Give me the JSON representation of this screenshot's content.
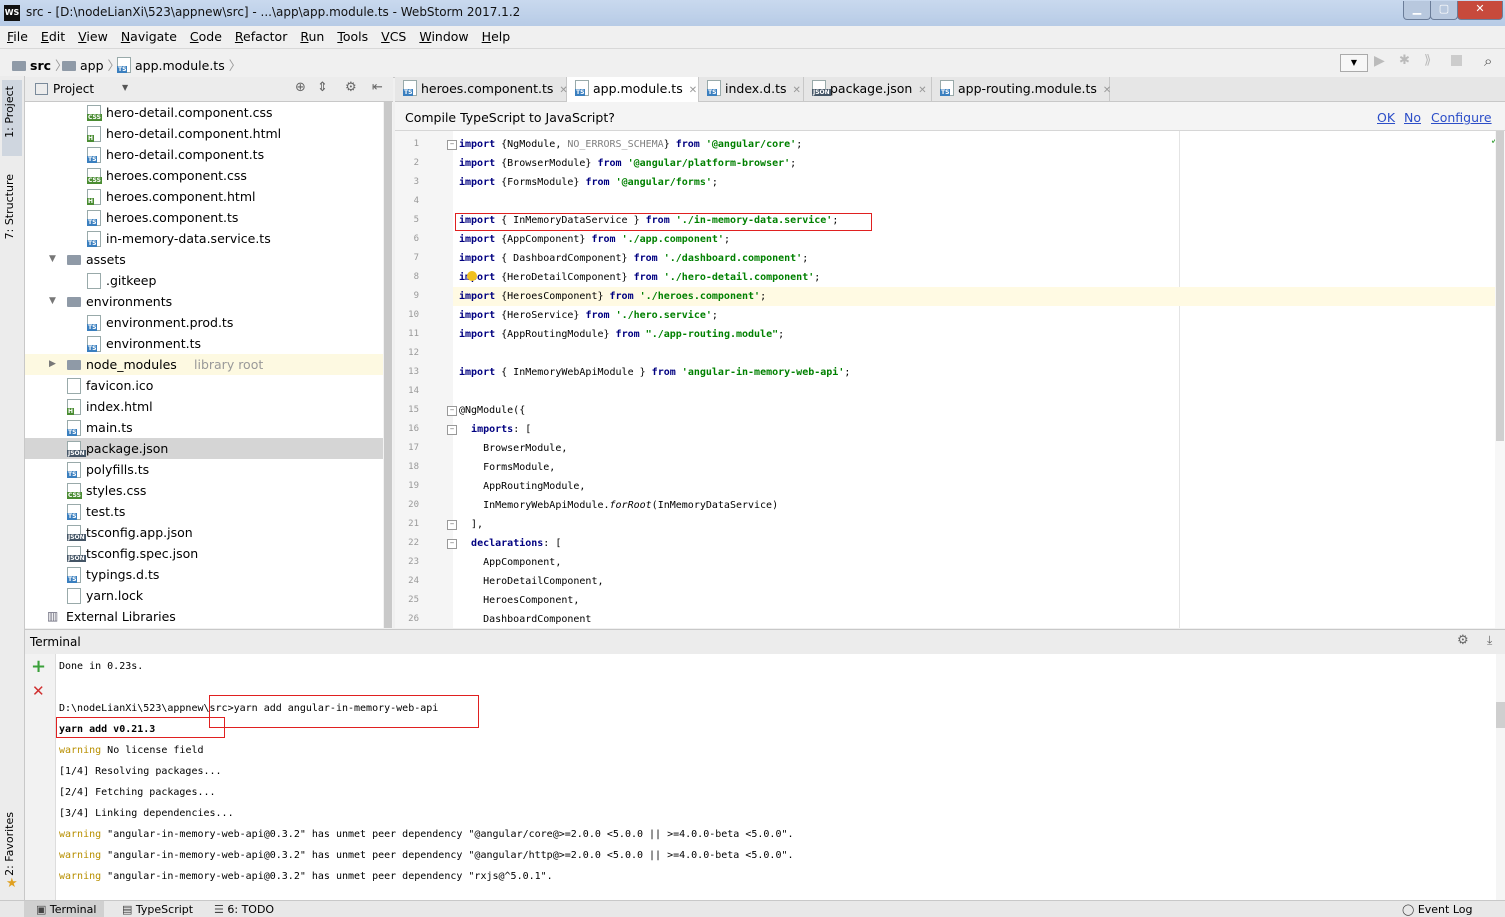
{
  "window": {
    "title": "src - [D:\\nodeLianXi\\523\\appnew\\src] - ...\\app\\app.module.ts - WebStorm 2017.1.2",
    "app_icon": "WS",
    "controls": [
      "minimize-icon",
      "maximize-icon",
      "close-icon"
    ]
  },
  "menu": [
    "File",
    "Edit",
    "View",
    "Navigate",
    "Code",
    "Refactor",
    "Run",
    "Tools",
    "VCS",
    "Window",
    "Help"
  ],
  "breadcrumb": [
    "src",
    "app",
    "app.module.ts"
  ],
  "left_stripe": {
    "project_tab": "1: Project",
    "structure_tab": "7: Structure",
    "favorites_tab": "2: Favorites"
  },
  "project_panel": {
    "title": "Project",
    "tree": [
      {
        "label": "hero-detail.component.css",
        "type": "css",
        "depth": 3
      },
      {
        "label": "hero-detail.component.html",
        "type": "html",
        "depth": 3
      },
      {
        "label": "hero-detail.component.ts",
        "type": "ts",
        "depth": 3
      },
      {
        "label": "heroes.component.css",
        "type": "css",
        "depth": 3
      },
      {
        "label": "heroes.component.html",
        "type": "html",
        "depth": 3
      },
      {
        "label": "heroes.component.ts",
        "type": "ts",
        "depth": 3
      },
      {
        "label": "in-memory-data.service.ts",
        "type": "ts",
        "depth": 3
      },
      {
        "label": "assets",
        "type": "folder",
        "depth": 2,
        "expanded": true
      },
      {
        "label": ".gitkeep",
        "type": "txt",
        "depth": 3
      },
      {
        "label": "environments",
        "type": "folder",
        "depth": 2,
        "expanded": true
      },
      {
        "label": "environment.prod.ts",
        "type": "ts",
        "depth": 3
      },
      {
        "label": "environment.ts",
        "type": "ts",
        "depth": 3
      },
      {
        "label": "node_modules",
        "type": "folder",
        "depth": 2,
        "expanded": false,
        "hint": "library root",
        "highlight": true
      },
      {
        "label": "favicon.ico",
        "type": "txt",
        "depth": 2
      },
      {
        "label": "index.html",
        "type": "html",
        "depth": 2
      },
      {
        "label": "main.ts",
        "type": "ts",
        "depth": 2
      },
      {
        "label": "package.json",
        "type": "json",
        "depth": 2,
        "selected": true
      },
      {
        "label": "polyfills.ts",
        "type": "ts",
        "depth": 2
      },
      {
        "label": "styles.css",
        "type": "css",
        "depth": 2
      },
      {
        "label": "test.ts",
        "type": "ts",
        "depth": 2
      },
      {
        "label": "tsconfig.app.json",
        "type": "json",
        "depth": 2
      },
      {
        "label": "tsconfig.spec.json",
        "type": "json",
        "depth": 2
      },
      {
        "label": "typings.d.ts",
        "type": "ts",
        "depth": 2
      },
      {
        "label": "yarn.lock",
        "type": "txt",
        "depth": 2
      },
      {
        "label": "External Libraries",
        "type": "lib",
        "depth": 1
      }
    ]
  },
  "editor_tabs": [
    {
      "label": "heroes.component.ts",
      "type": "ts",
      "active": false
    },
    {
      "label": "app.module.ts",
      "type": "ts",
      "active": true
    },
    {
      "label": "index.d.ts",
      "type": "ts",
      "active": false
    },
    {
      "label": "package.json",
      "type": "json",
      "active": false
    },
    {
      "label": "app-routing.module.ts",
      "type": "ts",
      "active": false
    }
  ],
  "notification": {
    "message": "Compile TypeScript to JavaScript?",
    "ok": "OK",
    "no": "No",
    "configure": "Configure"
  },
  "code_lines": [
    [
      [
        "k",
        "import"
      ],
      [
        "t",
        " {NgModule, "
      ],
      [
        "c",
        "NO_ERRORS_SCHEMA"
      ],
      [
        "t",
        "} "
      ],
      [
        "k",
        "from"
      ],
      [
        "t",
        " "
      ],
      [
        "s",
        "'@angular/core'"
      ],
      [
        "t",
        ";"
      ]
    ],
    [
      [
        "k",
        "import"
      ],
      [
        "t",
        " {BrowserModule} "
      ],
      [
        "k",
        "from"
      ],
      [
        "t",
        " "
      ],
      [
        "s",
        "'@angular/platform-browser'"
      ],
      [
        "t",
        ";"
      ]
    ],
    [
      [
        "k",
        "import"
      ],
      [
        "t",
        " {FormsModule} "
      ],
      [
        "k",
        "from"
      ],
      [
        "t",
        " "
      ],
      [
        "s",
        "'@angular/forms'"
      ],
      [
        "t",
        ";"
      ]
    ],
    [],
    [
      [
        "k",
        "import"
      ],
      [
        "t",
        " { InMemoryDataService } "
      ],
      [
        "k",
        "from"
      ],
      [
        "t",
        " "
      ],
      [
        "s",
        "'./in-memory-data.service'"
      ],
      [
        "t",
        ";"
      ]
    ],
    [
      [
        "k",
        "import"
      ],
      [
        "t",
        " {AppComponent} "
      ],
      [
        "k",
        "from"
      ],
      [
        "t",
        " "
      ],
      [
        "s",
        "'./app.component'"
      ],
      [
        "t",
        ";"
      ]
    ],
    [
      [
        "k",
        "import"
      ],
      [
        "t",
        " { DashboardComponent} "
      ],
      [
        "k",
        "from"
      ],
      [
        "t",
        " "
      ],
      [
        "s",
        "'./dashboard.component'"
      ],
      [
        "t",
        ";"
      ]
    ],
    [
      [
        "k",
        "import"
      ],
      [
        "t",
        " {HeroDetailComponent} "
      ],
      [
        "k",
        "from"
      ],
      [
        "t",
        " "
      ],
      [
        "s",
        "'./hero-detail.component'"
      ],
      [
        "t",
        ";"
      ]
    ],
    [
      [
        "k",
        "import"
      ],
      [
        "t",
        " {HeroesComponent} "
      ],
      [
        "k",
        "from"
      ],
      [
        "t",
        " "
      ],
      [
        "s",
        "'./heroes.component'"
      ],
      [
        "t",
        ";"
      ]
    ],
    [
      [
        "k",
        "import"
      ],
      [
        "t",
        " {HeroService} "
      ],
      [
        "k",
        "from"
      ],
      [
        "t",
        " "
      ],
      [
        "s",
        "'./hero.service'"
      ],
      [
        "t",
        ";"
      ]
    ],
    [
      [
        "k",
        "import"
      ],
      [
        "t",
        " {AppRoutingModule} "
      ],
      [
        "k",
        "from"
      ],
      [
        "t",
        " "
      ],
      [
        "s",
        "\"./app-routing.module\""
      ],
      [
        "t",
        ";"
      ]
    ],
    [],
    [
      [
        "k",
        "import"
      ],
      [
        "t",
        " { InMemoryWebApiModule } "
      ],
      [
        "k",
        "from"
      ],
      [
        "t",
        " "
      ],
      [
        "s",
        "'angular-in-memory-web-api'"
      ],
      [
        "t",
        ";"
      ]
    ],
    [],
    [
      [
        "t",
        "@NgModule({"
      ]
    ],
    [
      [
        "t",
        "  "
      ],
      [
        "k",
        "imports"
      ],
      [
        "t",
        ": ["
      ]
    ],
    [
      [
        "t",
        "    BrowserModule,"
      ]
    ],
    [
      [
        "t",
        "    FormsModule,"
      ]
    ],
    [
      [
        "t",
        "    AppRoutingModule,"
      ]
    ],
    [
      [
        "t",
        "    InMemoryWebApiModule."
      ],
      [
        "f",
        "forRoot"
      ],
      [
        "t",
        "(InMemoryDataService)"
      ]
    ],
    [
      [
        "t",
        "  ],"
      ]
    ],
    [
      [
        "t",
        "  "
      ],
      [
        "k",
        "declarations"
      ],
      [
        "t",
        ": ["
      ]
    ],
    [
      [
        "t",
        "    AppComponent,"
      ]
    ],
    [
      [
        "t",
        "    HeroDetailComponent,"
      ]
    ],
    [
      [
        "t",
        "    HeroesComponent,"
      ]
    ],
    [
      [
        "t",
        "    DashboardComponent"
      ]
    ]
  ],
  "current_line": 9,
  "terminal": {
    "title": "Terminal",
    "lines": [
      [
        [
          "t",
          "Done in 0.23s."
        ]
      ],
      [],
      [
        [
          "t",
          "D:\\nodeLianXi\\523\\appnew\\src>yarn add angular-in-memory-web-api"
        ]
      ],
      [
        [
          "b",
          "yarn add v0.21.3"
        ]
      ],
      [
        [
          "w",
          "warning"
        ],
        [
          "t",
          " No license field"
        ]
      ],
      [
        [
          "t",
          "[1/4] Resolving packages..."
        ]
      ],
      [
        [
          "t",
          "[2/4] Fetching packages..."
        ]
      ],
      [
        [
          "t",
          "[3/4] Linking dependencies..."
        ]
      ],
      [
        [
          "w",
          "warning"
        ],
        [
          "t",
          " \"angular-in-memory-web-api@0.3.2\" has unmet peer dependency \"@angular/core@>=2.0.0 <5.0.0 || >=4.0.0-beta <5.0.0\"."
        ]
      ],
      [
        [
          "w",
          "warning"
        ],
        [
          "t",
          " \"angular-in-memory-web-api@0.3.2\" has unmet peer dependency \"@angular/http@>=2.0.0 <5.0.0 || >=4.0.0-beta <5.0.0\"."
        ]
      ],
      [
        [
          "w",
          "warning"
        ],
        [
          "t",
          " \"angular-in-memory-web-api@0.3.2\" has unmet peer dependency \"rxjs@^5.0.1\"."
        ]
      ]
    ]
  },
  "status_tabs": [
    "Terminal",
    "TypeScript",
    "6: TODO"
  ],
  "event_log": "Event Log",
  "colors": {
    "keyword": "#000080",
    "string": "#008000",
    "warning": "#b88f00",
    "highlight_box": "#e02020",
    "link": "#2c4ec8"
  }
}
